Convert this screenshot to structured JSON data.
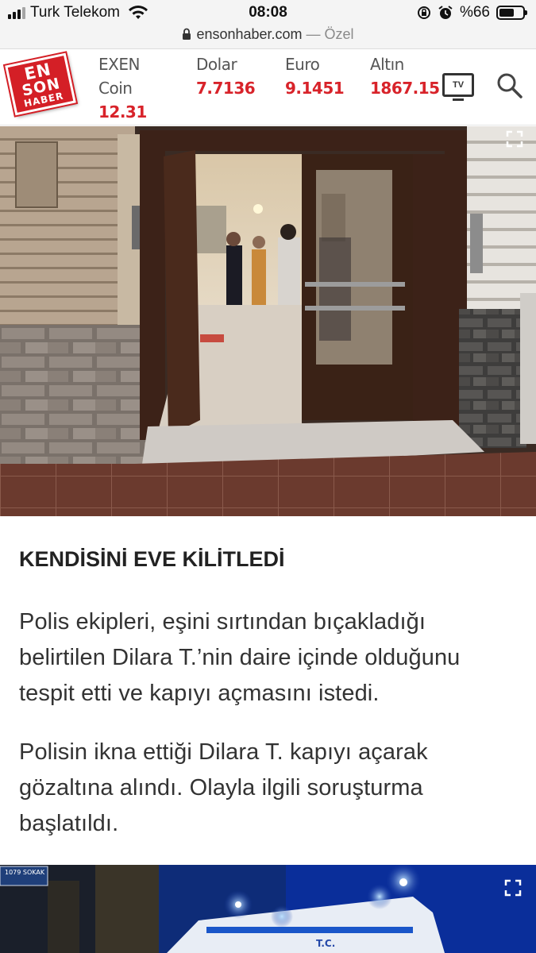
{
  "status_bar": {
    "carrier": "Turk Telekom",
    "time": "08:08",
    "battery_text": "%66",
    "battery_level": 0.66,
    "icons": [
      "signal-icon",
      "wifi-icon",
      "rotation-lock-icon",
      "alarm-icon",
      "battery-icon"
    ]
  },
  "url_bar": {
    "domain": "ensonhaber.com",
    "suffix": "— Özel"
  },
  "header": {
    "logo_lines": [
      "EN",
      "SON",
      "HABER"
    ],
    "tickers": [
      {
        "name": "EXEN",
        "name2": "Coin",
        "value": "12.31"
      },
      {
        "name": "Dolar",
        "value": "7.7136"
      },
      {
        "name": "Euro",
        "value": "9.1451"
      },
      {
        "name": "Altın",
        "value": "1867.15"
      }
    ],
    "tv_label": "TV",
    "accent_color": "#d8232a"
  },
  "article": {
    "subheading": "KENDİSİNİ EVE KİLİTLEDİ",
    "paragraphs": [
      [
        "Polis ekipleri, eşini sırtından bıçakladığı",
        "belirtilen Dilara T.’nin daire içinde olduğunu",
        "tespit etti ve kapıyı açmasını istedi."
      ],
      [
        "Polisin ikna ettiği Dilara T. kapıyı açarak",
        "gözaltına alındı. Olayla ilgili soruşturma",
        "başlatıldı."
      ]
    ]
  },
  "second_image": {
    "sign_text": "1079 SOKAK",
    "ambulance_text": "T.C."
  }
}
